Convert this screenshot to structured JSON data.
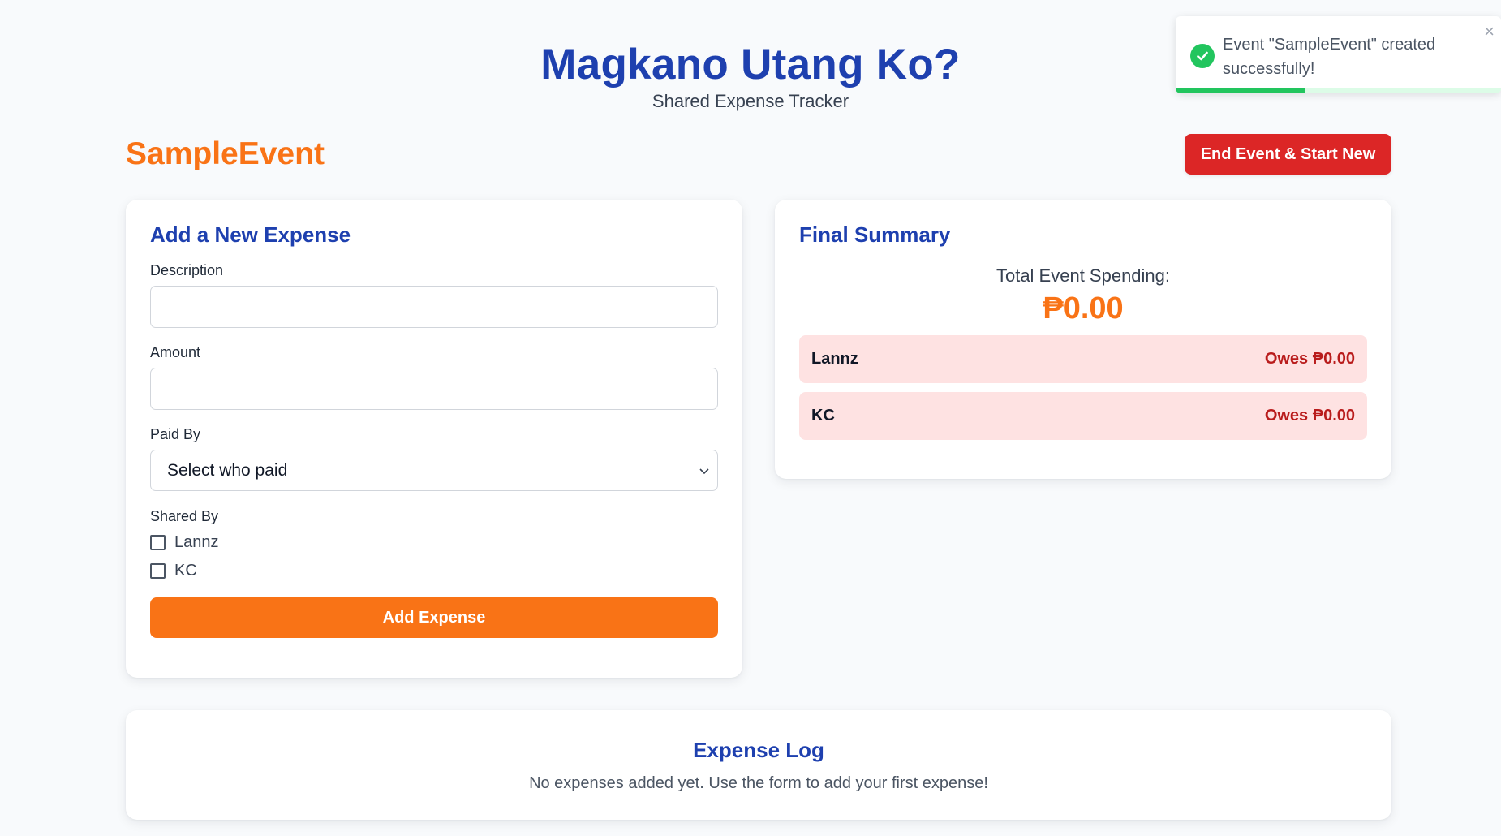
{
  "app": {
    "title": "Magkano Utang Ko?",
    "subtitle": "Shared Expense Tracker"
  },
  "event": {
    "name": "SampleEvent",
    "end_button_label": "End Event & Start New"
  },
  "add_expense": {
    "title": "Add a New Expense",
    "description_label": "Description",
    "description_value": "",
    "amount_label": "Amount",
    "amount_value": "",
    "paid_by_label": "Paid By",
    "paid_by_selected": "Select who paid",
    "shared_by_label": "Shared By",
    "participants": [
      {
        "name": "Lannz",
        "checked": false
      },
      {
        "name": "KC",
        "checked": false
      }
    ],
    "submit_label": "Add Expense"
  },
  "summary": {
    "title": "Final Summary",
    "total_label": "Total Event Spending:",
    "total_value": "₱0.00",
    "balances": [
      {
        "name": "Lannz",
        "status": "Owes ₱0.00"
      },
      {
        "name": "KC",
        "status": "Owes ₱0.00"
      }
    ]
  },
  "expense_log": {
    "title": "Expense Log",
    "empty_message": "No expenses added yet. Use the form to add your first expense!"
  },
  "toast": {
    "message": "Event \"SampleEvent\" created successfully!",
    "close_symbol": "×",
    "progress": 0.4,
    "icon": "check-circle-icon"
  },
  "colors": {
    "primary_blue": "#1e40af",
    "accent_orange": "#f97316",
    "danger_red": "#dc2626",
    "owes_bg": "#fee2e2",
    "success_green": "#22c55e"
  }
}
